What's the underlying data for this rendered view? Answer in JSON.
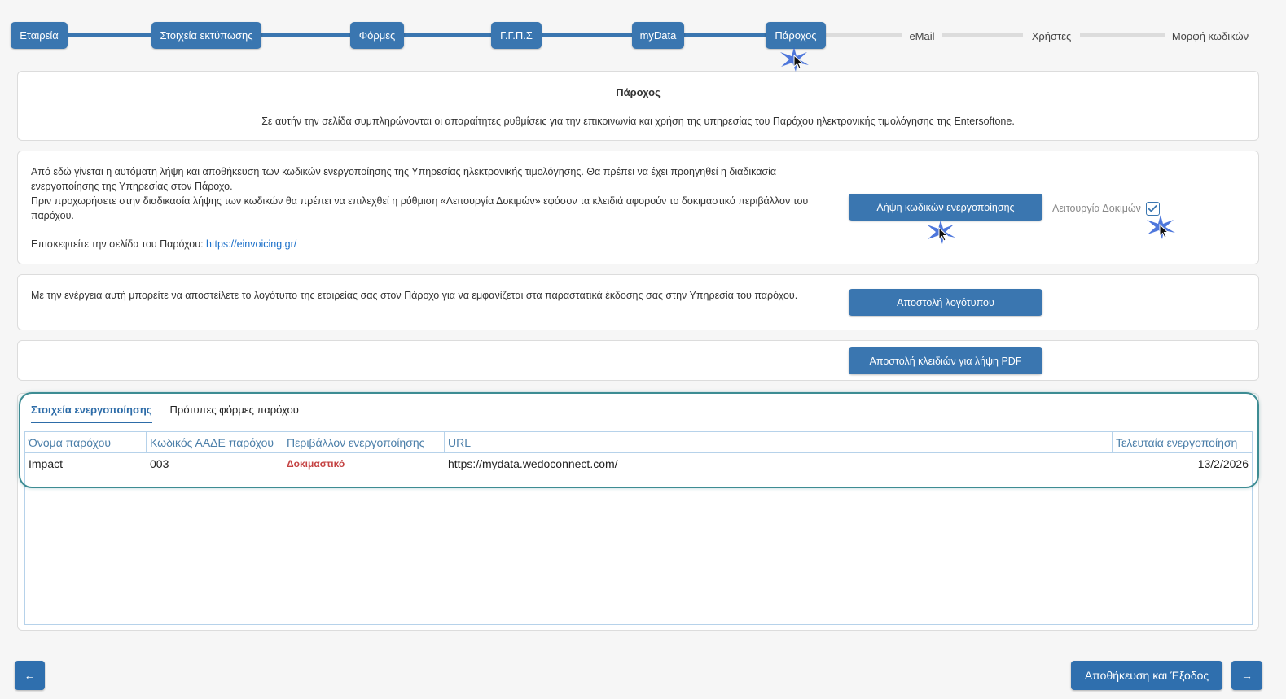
{
  "stepper": {
    "steps": [
      {
        "label": "Εταιρεία",
        "state": "done"
      },
      {
        "label": "Στοιχεία εκτύπωσης",
        "state": "done"
      },
      {
        "label": "Φόρμες",
        "state": "done"
      },
      {
        "label": "Γ.Γ.Π.Σ",
        "state": "done"
      },
      {
        "label": "myData",
        "state": "done"
      },
      {
        "label": "Πάροχος",
        "state": "current"
      },
      {
        "label": "eMail",
        "state": "todo"
      },
      {
        "label": "Χρήστες",
        "state": "todo"
      },
      {
        "label": "Μορφή κωδικών",
        "state": "todo"
      }
    ]
  },
  "intro": {
    "title": "Πάροχος",
    "description": "Σε αυτήν την σελίδα συμπληρώνονται οι απαραίτητες ρυθμίσεις για την επικοινωνία και χρήση της υπηρεσίας του Παρόχου ηλεκτρονικής τιμολόγησης της Entersoftone."
  },
  "activation": {
    "text_1": "Από εδώ γίνεται η αυτόματη λήψη και αποθήκευση των κωδικών ενεργοποίησης της Υπηρεσίας ηλεκτρονικής τιμολόγησης. Θα πρέπει να έχει προηγηθεί η διαδικασία ενεργοποίησης της Υπηρεσίας στον Πάροχο.",
    "text_2": "Πριν προχωρήσετε στην διαδικασία λήψης των κωδικών θα πρέπει να επιλεχθεί η ρύθμιση «Λειτουργία Δοκιμών» εφόσον τα κλειδιά αφορούν το δοκιμαστικό περιβάλλον του παρόχου.",
    "visit_label": "Επισκεφτείτε την σελίδα του Παρόχου:",
    "visit_link": "https://einvoicing.gr/",
    "button_label": "Λήψη κωδικών ενεργοποίησης",
    "test_mode_label": "Λειτουργία Δοκιμών",
    "test_mode_checked": true
  },
  "logo": {
    "text": "Με την ενέργεια αυτή μπορείτε να αποστείλετε το λογότυπο της εταιρείας σας στον Πάροχο για να εμφανίζεται στα παραστατικά έκδοσης σας στην Υπηρεσία του παρόχου.",
    "button_label": "Αποστολή λογότυπου"
  },
  "pdf": {
    "button_label": "Αποστολή κλειδιών για λήψη PDF"
  },
  "tabs": [
    {
      "label": "Στοιχεία ενεργοποίησης",
      "active": true
    },
    {
      "label": "Πρότυπες φόρμες παρόχου",
      "active": false
    }
  ],
  "grid": {
    "columns": [
      "Όνομα παρόχου",
      "Κωδικός ΑΑΔΕ παρόχου",
      "Περιβάλλον ενεργοποίησης",
      "URL",
      "Τελευταία ενεργοποίηση"
    ],
    "rows": [
      {
        "name": "Impact",
        "code": "003",
        "environment": "Δοκιμαστικό",
        "url": "https://mydata.wedoconnect.com/",
        "last_activation": "13/2/2026"
      }
    ]
  },
  "footer": {
    "back_symbol": "←",
    "save_exit_label": "Αποθήκευση και Έξοδος",
    "next_symbol": "→"
  },
  "colors": {
    "primary": "#3a76b0",
    "highlight": "#3d8c93",
    "environment_text": "#c44242",
    "link": "#1a6fc9"
  }
}
